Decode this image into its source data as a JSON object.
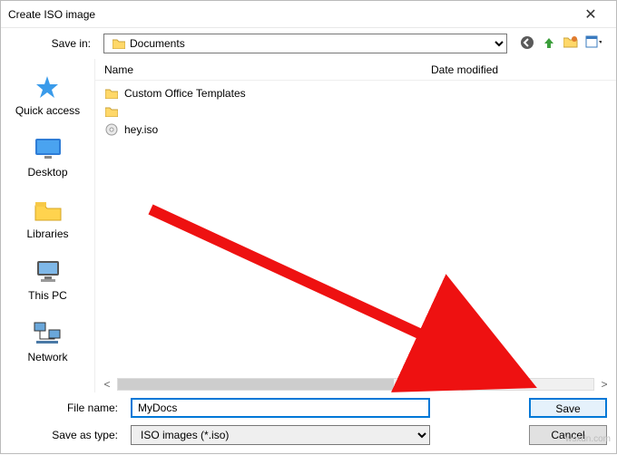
{
  "window": {
    "title": "Create ISO image"
  },
  "toolbar": {
    "save_in_label": "Save in:",
    "location": "Documents"
  },
  "columns": {
    "name": "Name",
    "date": "Date modified"
  },
  "files": [
    {
      "icon": "folder",
      "name": "Custom Office Templates"
    },
    {
      "icon": "folder",
      "name": ""
    },
    {
      "icon": "iso",
      "name": "hey.iso"
    }
  ],
  "sidebar": {
    "quick_access": "Quick access",
    "desktop": "Desktop",
    "libraries": "Libraries",
    "this_pc": "This PC",
    "network": "Network"
  },
  "form": {
    "filename_label": "File name:",
    "filename_value": "MyDocs",
    "saveas_label": "Save as type:",
    "saveas_value": "ISO images (*.iso)",
    "save": "Save",
    "cancel": "Cancel"
  },
  "watermark": "wsxdn.com"
}
